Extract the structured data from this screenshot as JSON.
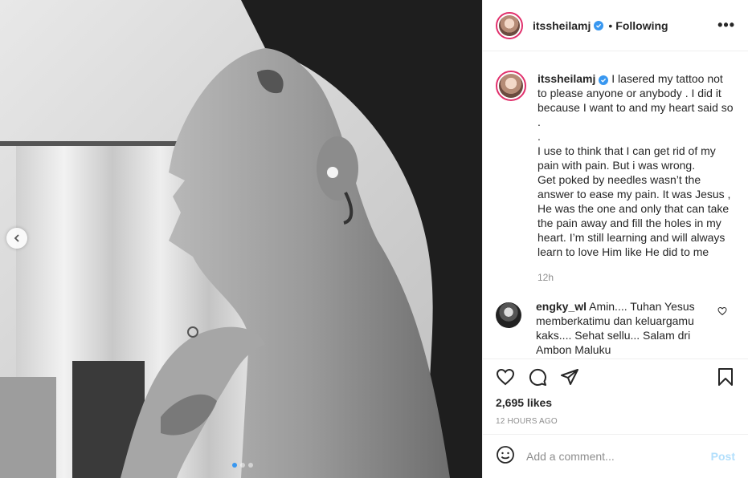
{
  "post": {
    "username": "itssheilamj",
    "verified": true,
    "separator": "•",
    "follow_status": "Following",
    "more_label": "•••"
  },
  "caption": {
    "username": "itssheilamj",
    "text": "I lasered my tattoo not to please anyone or anybody . I did it because I want to and my heart said so .\n.\nI use to think that I can get rid of my pain with pain. But i was wrong.\nGet poked by needles wasn’t the answer to ease my pain. It was Jesus , He was the one and only that can take the pain away and fill the holes in my heart. I’m still learning and will always learn to love Him like He did to me",
    "time": "12h"
  },
  "comments": [
    {
      "username": "engky_wl",
      "text": "Amin.... Tuhan Yesus memberkatimu dan keluargamu kaks.... Sehat sellu... Salam dri Ambon Maluku"
    }
  ],
  "stats": {
    "likes": "2,695 likes",
    "time_ago": "12 HOURS AGO"
  },
  "comment_box": {
    "placeholder": "Add a comment...",
    "post_label": "Post"
  },
  "carousel": {
    "slide_count": 3,
    "active_index": 0
  },
  "colors": {
    "verified_blue": "#3897f0",
    "story_ring": "#e1306c",
    "post_disabled": "#b2dffc",
    "secondary_text": "#8e8e8e"
  }
}
